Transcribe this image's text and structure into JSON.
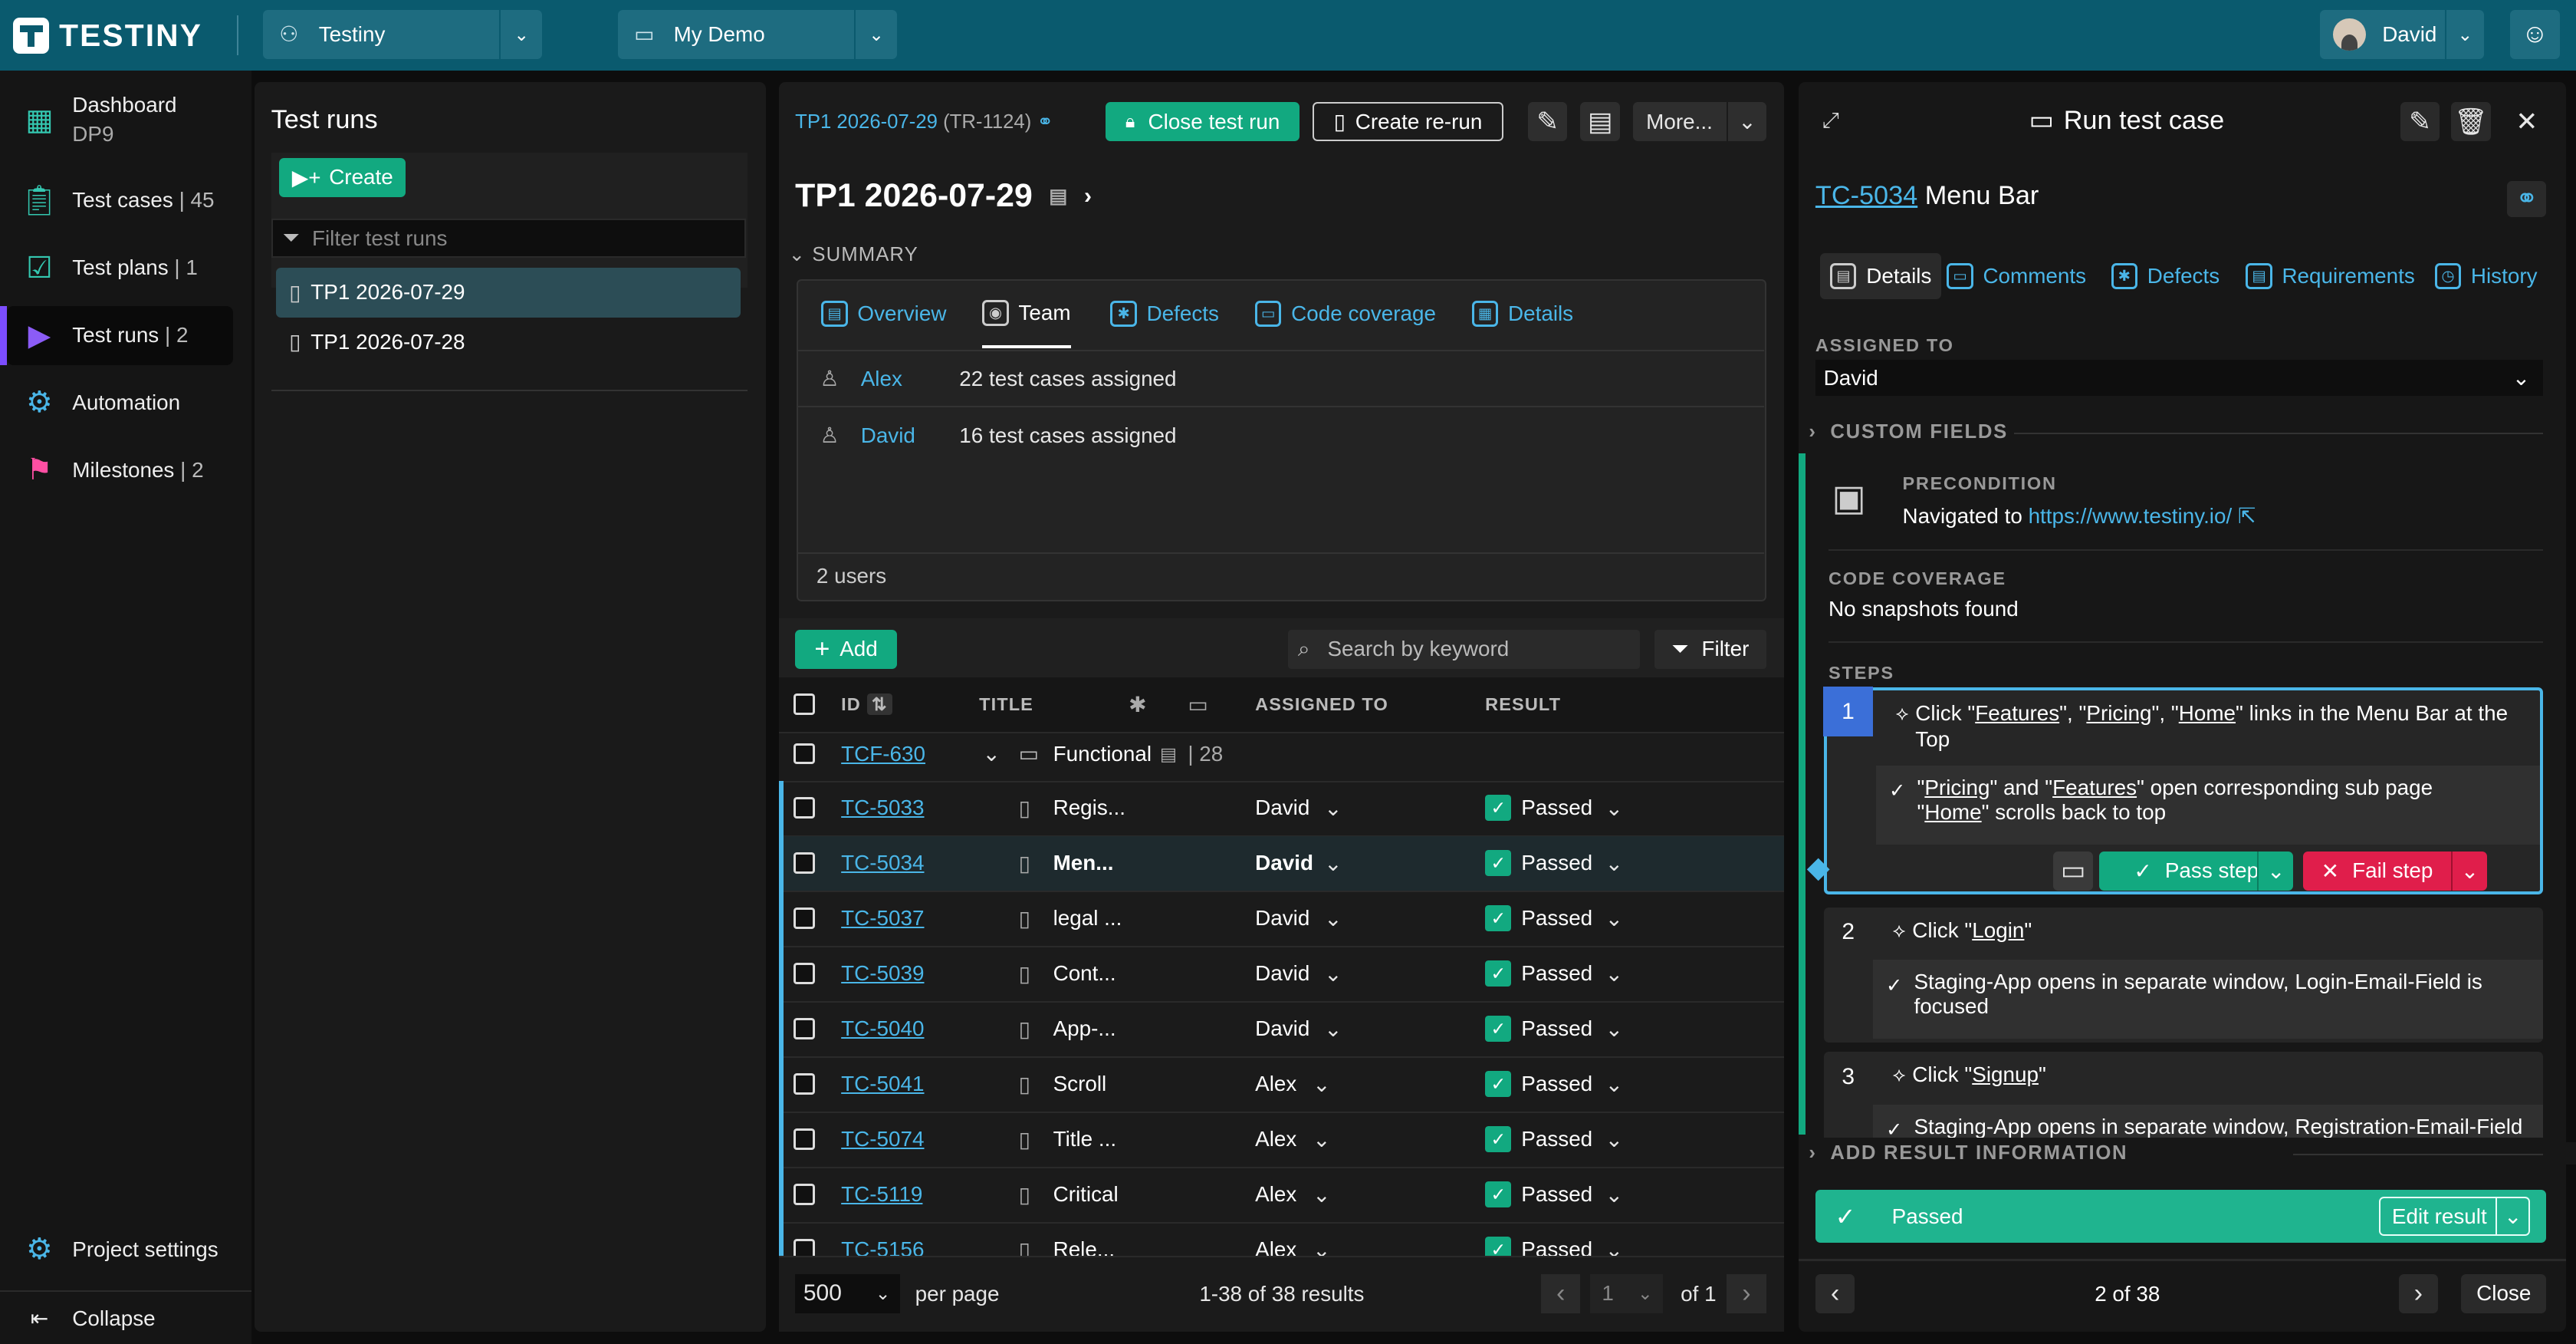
{
  "top": {
    "logo": "TESTINY",
    "project": "Testiny",
    "project_icon": "people-icon",
    "view": "My Demo",
    "view_icon": "monitor-icon",
    "user": "David"
  },
  "nav": {
    "dashboard": "Dashboard",
    "dashboard_sub": "DP9",
    "test_cases": "Test cases",
    "test_cases_count": "| 45",
    "test_plans": "Test plans",
    "test_plans_count": "| 1",
    "test_runs": "Test runs",
    "test_runs_count": "| 2",
    "automation": "Automation",
    "milestones": "Milestones",
    "milestones_count": "| 2",
    "project_settings": "Project settings",
    "collapse": "Collapse",
    "accent": "#7c4dff"
  },
  "runs": {
    "title": "Test runs",
    "create": "Create",
    "filter_placeholder": "Filter test runs",
    "items": [
      "TP1 2026-07-29",
      "TP1 2026-07-28"
    ]
  },
  "mid": {
    "crumb": "TP1 2026-07-29",
    "crumb_id": "(TR-1124)",
    "close_run": "Close test run",
    "create_rerun": "Create re-run",
    "more": "More...",
    "title": "TP1 2026-07-29",
    "summary": "SUMMARY",
    "tabs": [
      "Overview",
      "Team",
      "Defects",
      "Code coverage",
      "Details"
    ],
    "team": [
      {
        "name": "Alex",
        "info": "22 test cases assigned"
      },
      {
        "name": "David",
        "info": "16 test cases assigned"
      }
    ],
    "users_count": "2 users",
    "add": "Add",
    "search_placeholder": "Search by keyword",
    "filter": "Filter",
    "cols": {
      "id": "ID",
      "title": "TITLE",
      "assigned": "ASSIGNED TO",
      "result": "RESULT"
    },
    "folder": {
      "id": "TCF-630",
      "name": "Functional",
      "count": "| 28"
    },
    "rows": [
      {
        "id": "TC-5033",
        "title": "Regis...",
        "assigned": "David",
        "result": "Passed"
      },
      {
        "id": "TC-5034",
        "title": "Men...",
        "assigned": "David",
        "result": "Passed"
      },
      {
        "id": "TC-5037",
        "title": "legal ...",
        "assigned": "David",
        "result": "Passed"
      },
      {
        "id": "TC-5039",
        "title": "Cont...",
        "assigned": "David",
        "result": "Passed"
      },
      {
        "id": "TC-5040",
        "title": "App-...",
        "assigned": "David",
        "result": "Passed"
      },
      {
        "id": "TC-5041",
        "title": "Scroll",
        "assigned": "Alex",
        "result": "Passed"
      },
      {
        "id": "TC-5074",
        "title": "Title ...",
        "assigned": "Alex",
        "result": "Passed"
      },
      {
        "id": "TC-5119",
        "title": "Critical",
        "assigned": "Alex",
        "result": "Passed"
      },
      {
        "id": "TC-5156",
        "title": "Rele...",
        "assigned": "Alex",
        "result": "Passed"
      }
    ],
    "per_page_value": "500",
    "per_page": "per page",
    "results": "1-38 of 38 results",
    "page": "1",
    "of": "of 1"
  },
  "right": {
    "title": "Run test case",
    "tc_id": "TC-5034",
    "tc_name": "Menu Bar",
    "tabs": [
      "Details",
      "Comments",
      "Defects",
      "Requirements",
      "History"
    ],
    "assigned_label": "ASSIGNED TO",
    "assigned": "David",
    "custom_fields": "CUSTOM FIELDS",
    "precondition_label": "PRECONDITION",
    "precondition_text": "Navigated to",
    "precondition_link": "https://www.testiny.io/",
    "coverage_label": "CODE COVERAGE",
    "coverage_text": "No snapshots found",
    "steps_label": "STEPS",
    "steps": [
      {
        "n": "1",
        "action": [
          "Click \"",
          "Features",
          "\", \"",
          "Pricing",
          "\", \"",
          "Home",
          "\" links in the Menu Bar at the Top"
        ],
        "expected1": [
          "\"",
          "Pricing",
          "\" and \"",
          "Features",
          "\" open corresponding sub page"
        ],
        "expected2": [
          "\"",
          "Home",
          "\" scrolls back to top"
        ]
      },
      {
        "n": "2",
        "action": [
          "Click \"",
          "Login",
          "\""
        ],
        "expected": "Staging-App opens in separate window, Login-Email-Field is focused"
      },
      {
        "n": "3",
        "action": [
          "Click \"",
          "Signup",
          "\""
        ],
        "expected": "Staging-App opens in separate window, Registration-Email-Field is"
      }
    ],
    "pass_step": "Pass step",
    "fail_step": "Fail step",
    "add_result": "ADD RESULT INFORMATION",
    "result": "Passed",
    "edit_result": "Edit result",
    "position": "2 of 38",
    "close": "Close"
  }
}
